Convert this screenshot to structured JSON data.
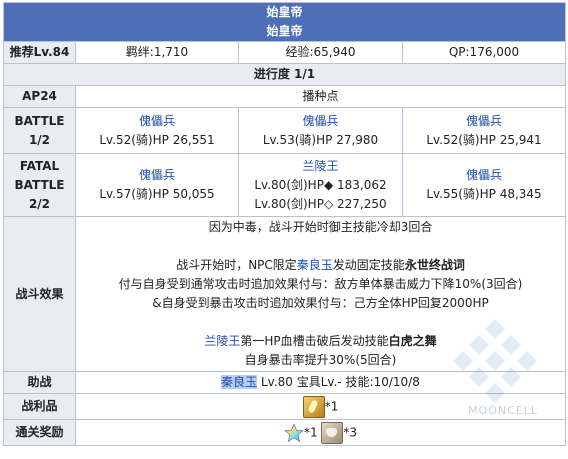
{
  "quest": {
    "title_line1": "始皇帝",
    "title_line2": "始皇帝",
    "recommend": "推荐Lv.84",
    "bond": "羁绊:1,710",
    "exp": "经验:65,940",
    "qp": "QP:176,000",
    "progress": "进行度 1/1",
    "ap": "AP24",
    "ap_value": "播种点"
  },
  "battles": [
    {
      "label1": "BATTLE",
      "label2": "1/2",
      "enemies": [
        {
          "name": "傀儡兵",
          "stats": "Lv.52(骑)HP 26,551"
        },
        {
          "name": "傀儡兵",
          "stats": "Lv.53(骑)HP 27,980"
        },
        {
          "name": "傀儡兵",
          "stats": "Lv.52(骑)HP 25,941"
        }
      ]
    },
    {
      "label1": "FATAL",
      "label2": "BATTLE",
      "label3": "2/2",
      "enemies": [
        {
          "name": "傀儡兵",
          "stats": "Lv.57(骑)HP 50,055"
        },
        {
          "name": "兰陵王",
          "stats": "Lv.80(剑)HP◆ 183,062",
          "stats2": "Lv.80(剑)HP◇ 227,250"
        },
        {
          "name": "傀儡兵",
          "stats": "Lv.55(骑)HP 48,345"
        }
      ]
    }
  ],
  "effects": {
    "label": "战斗效果",
    "line1": "因为中毒，战斗开始时御主技能冷却3回合",
    "line2_pre": "战斗开始时，NPC限定",
    "line2_link": "秦良玉",
    "line2_mid": "发动固定技能",
    "line2_skill": "永世终战词",
    "line3": "付与自身受到通常攻击时追加效果付与：敌方单体暴击威力下降10%(3回合)",
    "line4": "&自身受到暴击攻击时追加效果付与：己方全体HP回复2000HP",
    "line5_link": "兰陵王",
    "line5_mid": "第一HP血槽击破后发动技能",
    "line5_skill": "白虎之舞",
    "line6": "自身暴击率提升30%(5回合)"
  },
  "support": {
    "label": "助战",
    "name": "秦良玉",
    "detail": " Lv.80 宝具Lv.- 技能:10/10/8"
  },
  "drops": {
    "label": "战利品",
    "item_count": "*1",
    "icon": "bone-icon"
  },
  "rewards": {
    "label": "通关奖励",
    "item1_count": "*1",
    "item2_count": "*3",
    "icon1": "rainbow-star-icon",
    "icon2": "grail-icon"
  },
  "watermark": "MOONCELL",
  "colors": {
    "title_bg": "#4e6fb8",
    "header_bg": "#e9ecf1",
    "border": "#b8c2d4",
    "link": "#1f4fb0",
    "highlight": "#b9cdf0"
  }
}
